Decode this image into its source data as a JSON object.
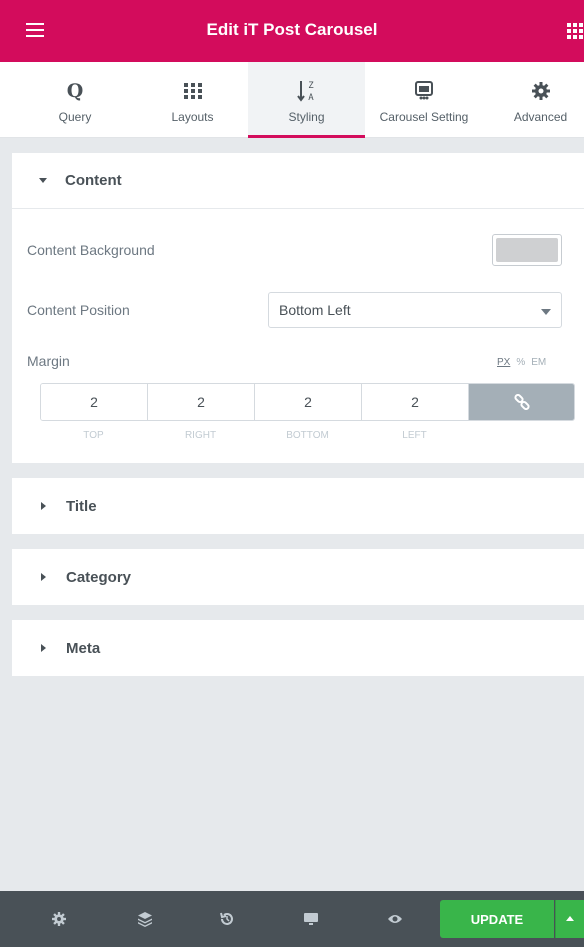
{
  "header": {
    "title": "Edit iT Post Carousel"
  },
  "tabs": [
    {
      "label": "Query",
      "icon": "query-q-icon"
    },
    {
      "label": "Layouts",
      "icon": "grid-icon"
    },
    {
      "label": "Styling",
      "icon": "sort-az-icon",
      "active": true
    },
    {
      "label": "Carousel Setting",
      "icon": "slides-icon"
    },
    {
      "label": "Advanced",
      "icon": "gear-icon"
    }
  ],
  "content_section": {
    "title": "Content",
    "background_label": "Content Background",
    "background_color": "#cfd0d2",
    "position_label": "Content Position",
    "position_value": "Bottom Left",
    "margin_label": "Margin",
    "units": {
      "px": "PX",
      "percent": "%",
      "em": "EM"
    },
    "margin": {
      "top": "2",
      "right": "2",
      "bottom": "2",
      "left": "2"
    },
    "margin_labels": {
      "top": "TOP",
      "right": "RIGHT",
      "bottom": "BOTTOM",
      "left": "LEFT"
    }
  },
  "collapsed_sections": [
    {
      "title": "Title"
    },
    {
      "title": "Category"
    },
    {
      "title": "Meta"
    }
  ],
  "footer": {
    "update_label": "UPDATE"
  },
  "colors": {
    "brand": "#d30c5c",
    "update": "#39b54a",
    "footer": "#495157"
  }
}
